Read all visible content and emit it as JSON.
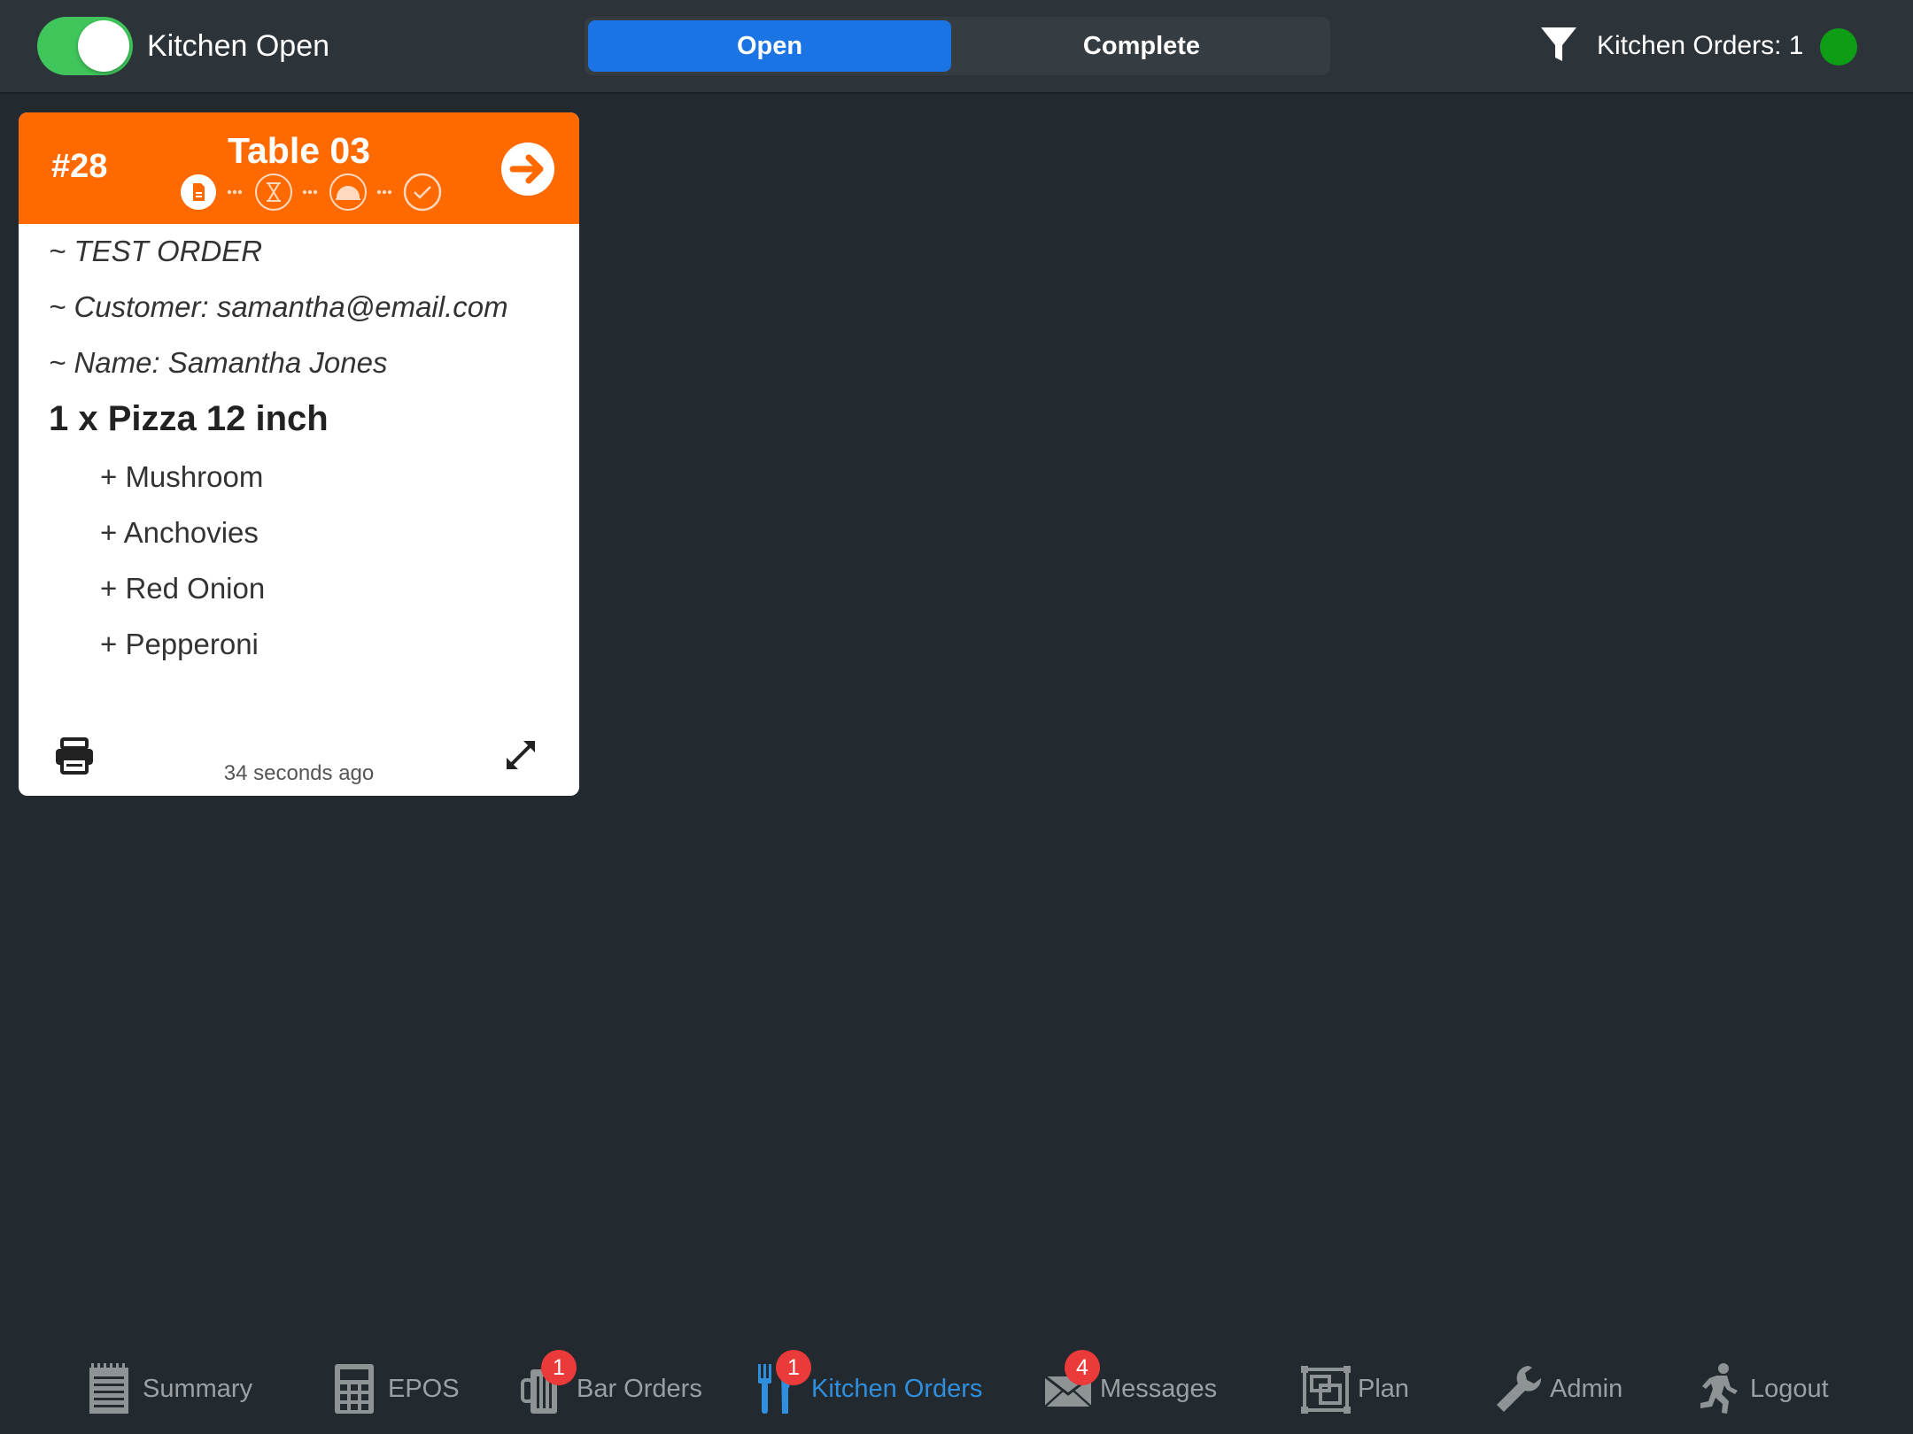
{
  "topbar": {
    "kitchen_toggle_label": "Kitchen Open",
    "kitchen_open": true,
    "segments": {
      "open": "Open",
      "complete": "Complete",
      "selected": "Open"
    },
    "orders_count_text": "Kitchen Orders: 1",
    "status_color": "#0d9e16"
  },
  "order": {
    "number": "#28",
    "table": "Table 03",
    "header_color": "#ff6a00",
    "progress_steps": [
      "document-icon",
      "hourglass-icon",
      "cloche-icon",
      "checkmark-icon"
    ],
    "notes": [
      "~ TEST ORDER",
      "~ Customer: samantha@email.com",
      "~ Name: Samantha Jones"
    ],
    "item": "1 x Pizza 12 inch",
    "modifiers": [
      "+ Mushroom",
      "+ Anchovies",
      "+ Red Onion",
      "+ Pepperoni"
    ],
    "age": "34 seconds ago"
  },
  "tabs": [
    {
      "label": "Summary",
      "icon": "notepad-icon",
      "badge": null
    },
    {
      "label": "EPOS",
      "icon": "calculator-icon",
      "badge": null
    },
    {
      "label": "Bar Orders",
      "icon": "glass-icon",
      "badge": "1"
    },
    {
      "label": "Kitchen Orders",
      "icon": "fork-knife-icon",
      "badge": "1"
    },
    {
      "label": "Messages",
      "icon": "envelope-icon",
      "badge": "4"
    },
    {
      "label": "Plan",
      "icon": "floor-plan-icon",
      "badge": null
    },
    {
      "label": "Admin",
      "icon": "wrench-icon",
      "badge": null
    },
    {
      "label": "Logout",
      "icon": "running-man-icon",
      "badge": null
    }
  ],
  "active_tab": "Kitchen Orders",
  "colors": {
    "accent": "#1b74e4",
    "active_tab": "#2f8fde",
    "badge": "#ea3a3a"
  }
}
